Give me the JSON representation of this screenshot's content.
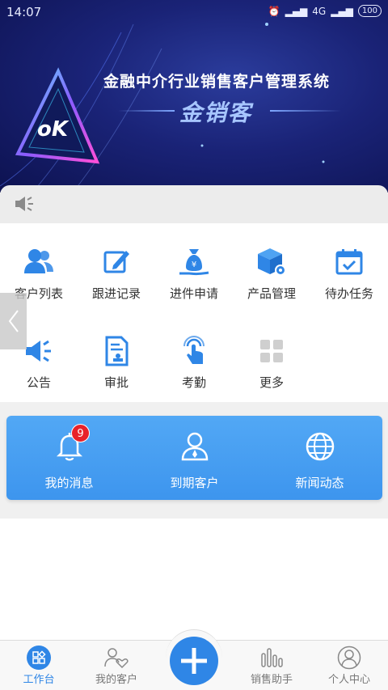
{
  "status_bar": {
    "time": "14:07",
    "signal": "4G",
    "battery": "100"
  },
  "banner": {
    "title": "金融中介行业销售客户管理系统",
    "brand": "金销客"
  },
  "grid": {
    "row1": [
      {
        "label": "客户列表",
        "icon": "users-icon"
      },
      {
        "label": "跟进记录",
        "icon": "edit-icon"
      },
      {
        "label": "进件申请",
        "icon": "money-bag-icon"
      },
      {
        "label": "产品管理",
        "icon": "product-box-icon"
      },
      {
        "label": "待办任务",
        "icon": "calendar-check-icon"
      }
    ],
    "row2": [
      {
        "label": "公告",
        "icon": "megaphone-icon"
      },
      {
        "label": "审批",
        "icon": "approval-document-icon"
      },
      {
        "label": "考勤",
        "icon": "tap-finger-icon"
      },
      {
        "label": "更多",
        "icon": "grid-more-icon"
      }
    ]
  },
  "card": {
    "items": [
      {
        "label": "我的消息",
        "icon": "bell-icon",
        "badge": "9"
      },
      {
        "label": "到期客户",
        "icon": "person-icon"
      },
      {
        "label": "新闻动态",
        "icon": "globe-icon"
      }
    ]
  },
  "tabbar": {
    "items": [
      {
        "label": "工作台",
        "icon": "workbench-icon",
        "active": true
      },
      {
        "label": "我的客户",
        "icon": "customers-heart-icon"
      },
      {
        "label": "",
        "icon": "plus-icon"
      },
      {
        "label": "销售助手",
        "icon": "bar-chart-icon"
      },
      {
        "label": "个人中心",
        "icon": "profile-icon"
      }
    ]
  },
  "colors": {
    "accent": "#2f86e6",
    "card": "#4a9ff2",
    "badge": "#e8222a",
    "banner": "#1a2377"
  }
}
